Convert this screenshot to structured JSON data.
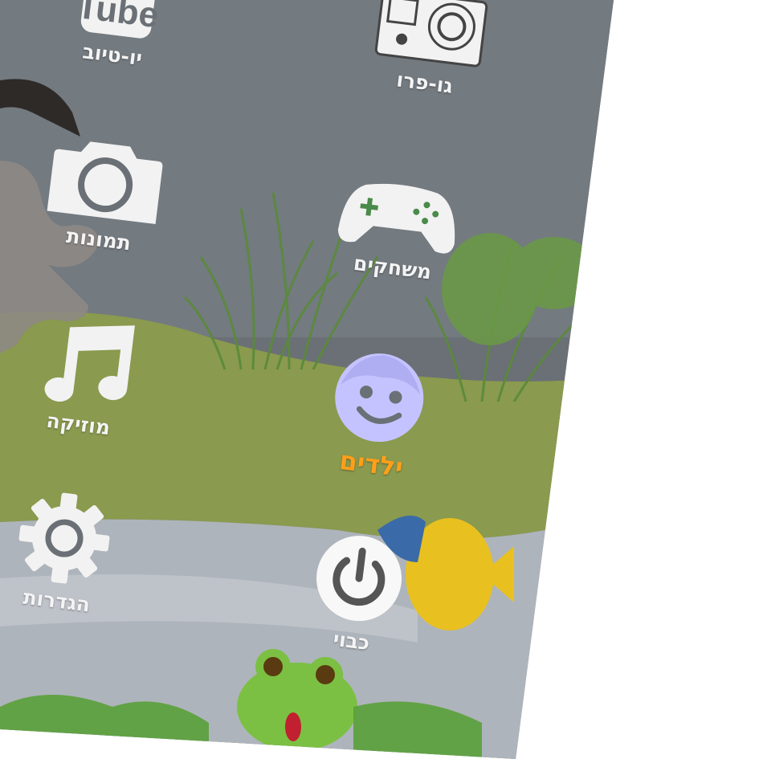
{
  "menu": {
    "youtube": {
      "label": "יו-טיוב",
      "logo_text": "Tube",
      "icon": "youtube-icon"
    },
    "gopro": {
      "label": "גו-פרו",
      "icon": "camera-gopro-icon"
    },
    "photos": {
      "label": "תמונות",
      "icon": "camera-icon"
    },
    "games": {
      "label": "משחקים",
      "icon": "gamepad-icon"
    },
    "music": {
      "label": "מוזיקה",
      "icon": "music-note-icon"
    },
    "kids": {
      "label": "ילדים",
      "icon": "kid-face-icon",
      "selected": true
    },
    "settings": {
      "label": "הגדרות",
      "icon": "gear-icon"
    },
    "power": {
      "label": "כבוי",
      "icon": "power-icon"
    }
  },
  "colors": {
    "active_label": "#ff9f1a",
    "label": "#f4f4f4",
    "kids_icon": "#c5c3ff"
  }
}
